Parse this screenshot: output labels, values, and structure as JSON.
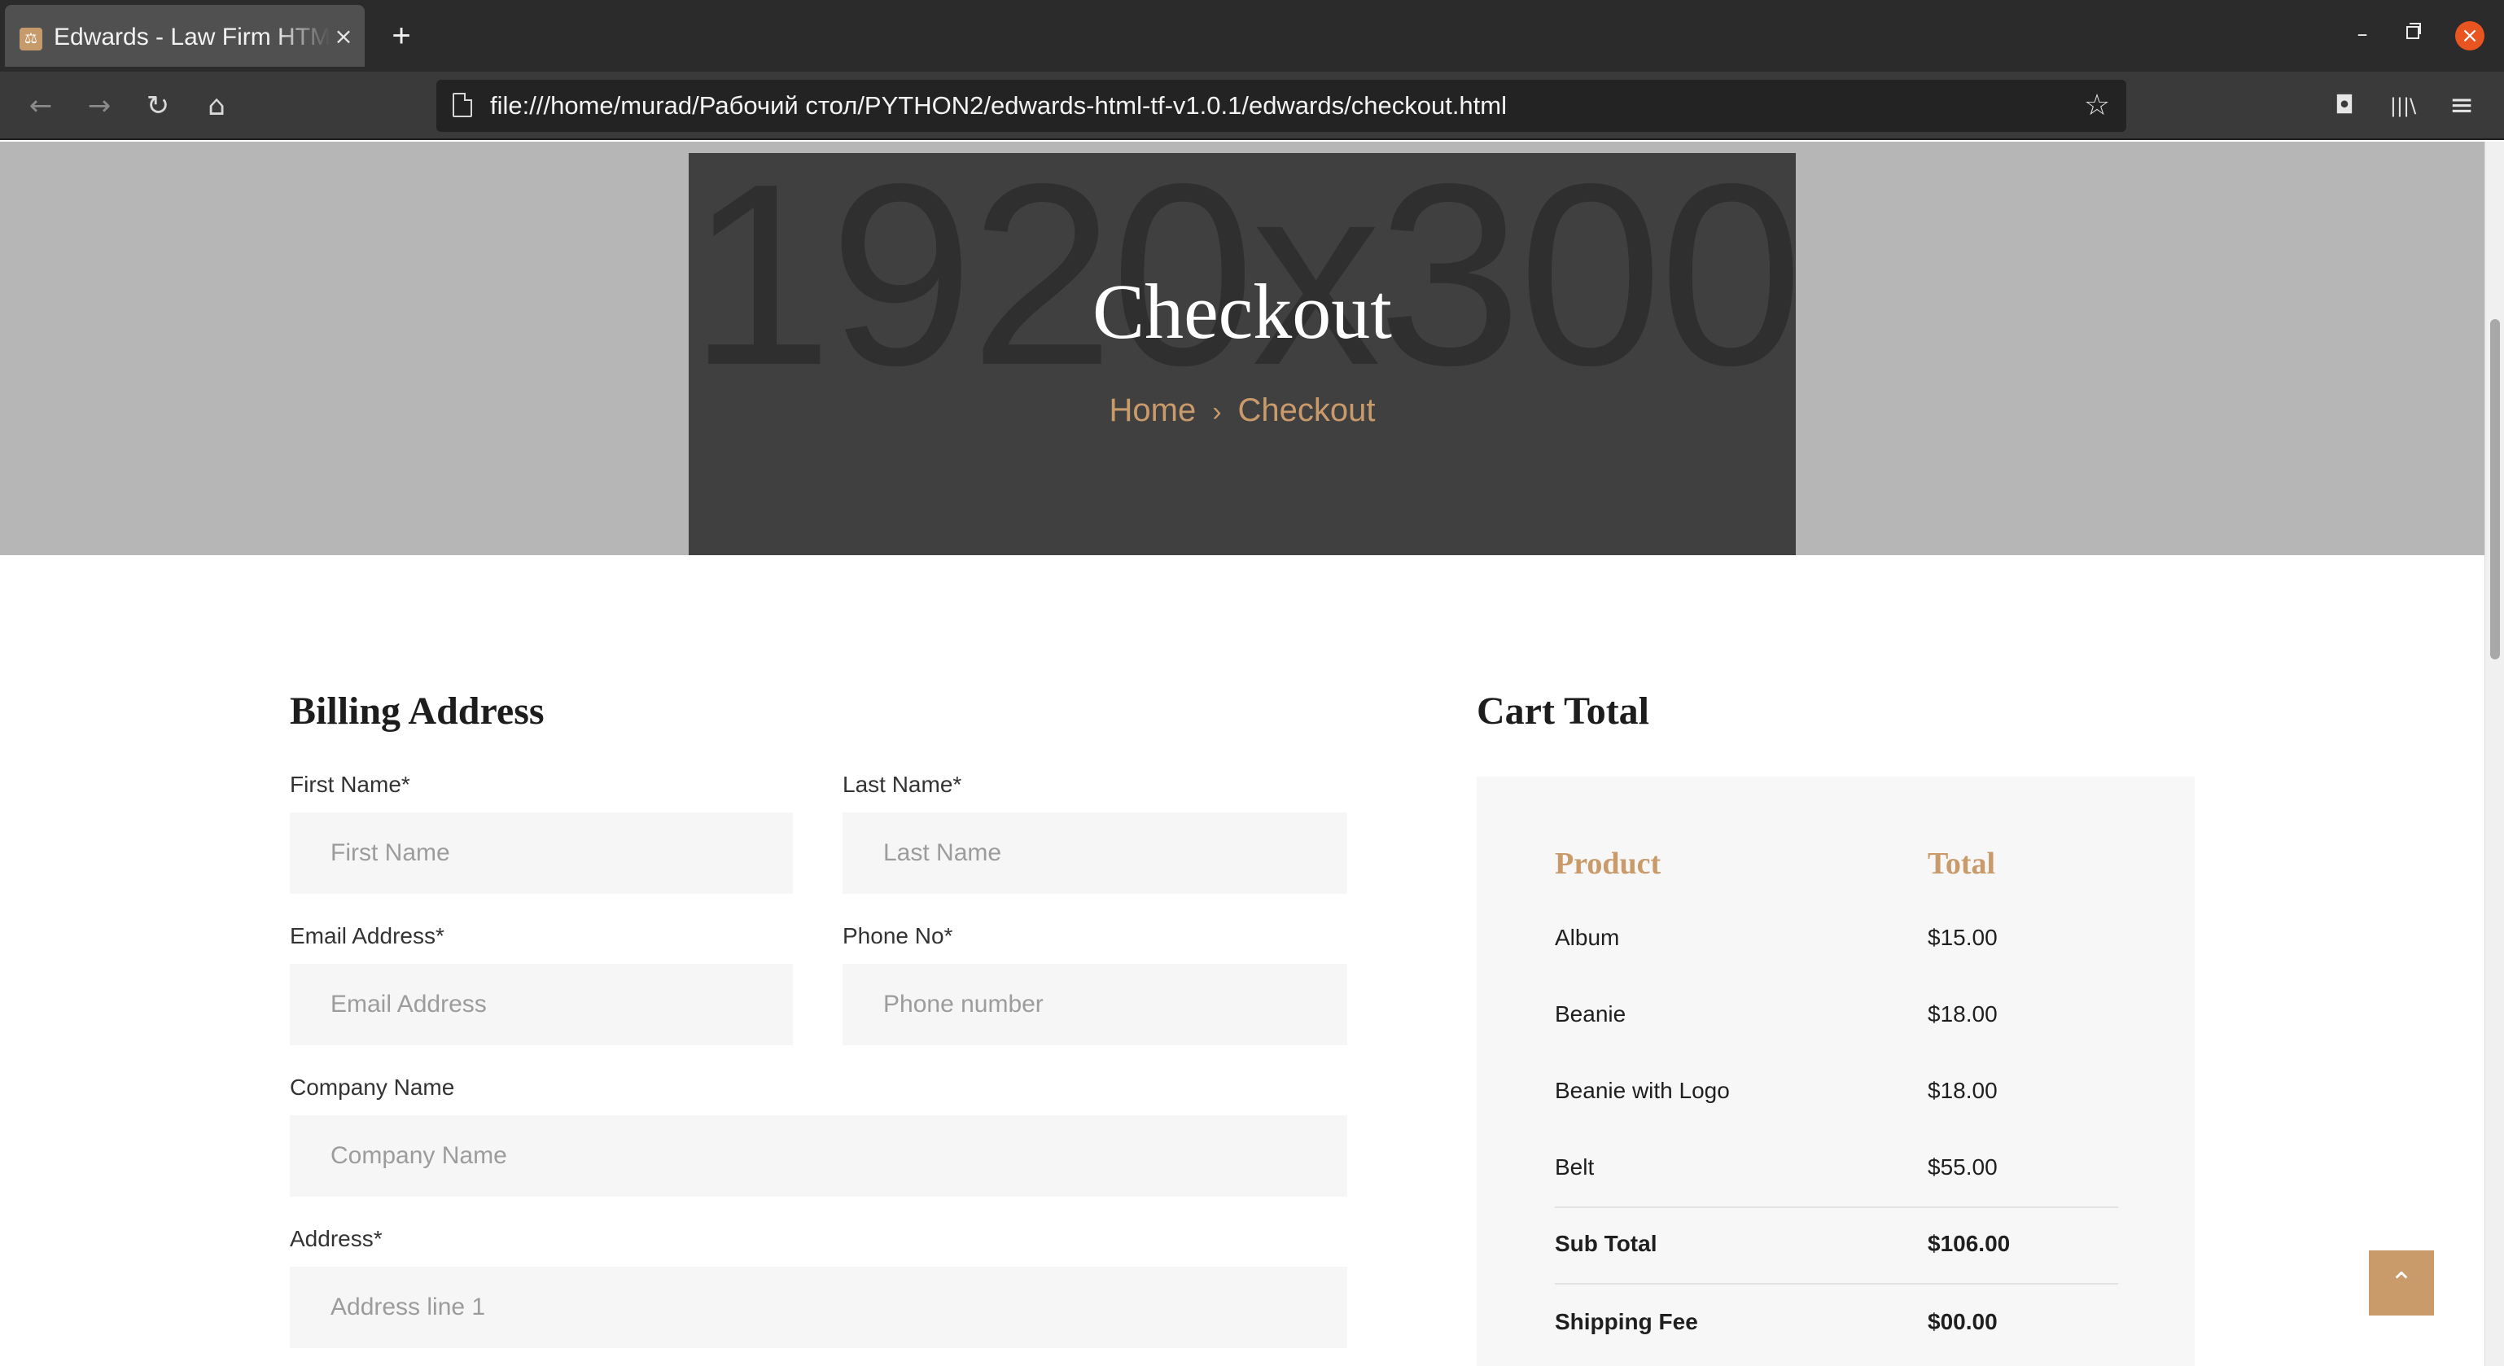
{
  "browser": {
    "tab_title": "Edwards - Law Firm HTML",
    "tab_close": "×",
    "new_tab": "+",
    "url": "file:///home/murad/Рабочий стол/PYTHON2/edwards-html-tf-v1.0.1/edwards/checkout.html",
    "icons": {
      "back": "←",
      "forward": "→",
      "reload": "↻",
      "home": "⌂",
      "star": "☆",
      "pocket": "◘",
      "library": "|||\\",
      "menu": "≡",
      "minimize": "–",
      "close": "×"
    }
  },
  "hero": {
    "placeholder_text": "1920x300",
    "title": "Checkout",
    "breadcrumb": {
      "home": "Home",
      "separator": "›",
      "current": "Checkout"
    }
  },
  "billing": {
    "title": "Billing Address",
    "first_name": {
      "label": "First Name*",
      "placeholder": "First Name"
    },
    "last_name": {
      "label": "Last Name*",
      "placeholder": "Last Name"
    },
    "email": {
      "label": "Email Address*",
      "placeholder": "Email Address"
    },
    "phone": {
      "label": "Phone No*",
      "placeholder": "Phone number"
    },
    "company": {
      "label": "Company Name",
      "placeholder": "Company Name"
    },
    "address": {
      "label": "Address*",
      "placeholder": "Address line 1"
    }
  },
  "cart": {
    "title": "Cart Total",
    "col_product": "Product",
    "col_total": "Total",
    "items": [
      {
        "product": "Album",
        "total": "$15.00"
      },
      {
        "product": "Beanie",
        "total": "$18.00"
      },
      {
        "product": "Beanie with Logo",
        "total": "$18.00"
      },
      {
        "product": "Belt",
        "total": "$55.00"
      }
    ],
    "subtotal": {
      "label": "Sub Total",
      "value": "$106.00"
    },
    "shipping": {
      "label": "Shipping Fee",
      "value": "$00.00"
    }
  },
  "back_to_top": "⌃",
  "colors": {
    "accent": "#c99a6a",
    "hero_bg": "#404040",
    "field_bg": "#f6f6f6"
  }
}
